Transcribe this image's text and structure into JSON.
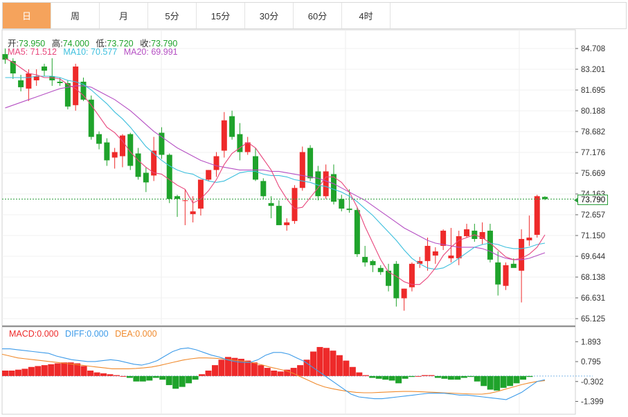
{
  "tabs": [
    {
      "label": "日",
      "active": true
    },
    {
      "label": "周",
      "active": false
    },
    {
      "label": "月",
      "active": false
    },
    {
      "label": "5分",
      "active": false
    },
    {
      "label": "15分",
      "active": false
    },
    {
      "label": "30分",
      "active": false
    },
    {
      "label": "60分",
      "active": false
    },
    {
      "label": "4时",
      "active": false
    }
  ],
  "ohlc_info": {
    "open_label": "开:",
    "open": "73.950",
    "high_label": "高:",
    "high": "74.000",
    "low_label": "低:",
    "low": "73.720",
    "close_label": "收:",
    "close": "73.790"
  },
  "ma_info": {
    "ma5_label": "MA5:",
    "ma5": "71.512",
    "ma10_label": "MA10:",
    "ma10": "70.577",
    "ma20_label": "MA20:",
    "ma20": "69.991"
  },
  "macd_info": {
    "macd_label": "MACD:",
    "macd": "0.000",
    "diff_label": "DIFF:",
    "diff": "0.000",
    "dea_label": "DEA:",
    "dea": "0.000"
  },
  "price_tag": "73.790",
  "colors": {
    "up": "#ee2a2a",
    "down": "#1fa32b",
    "ma5": "#e8467c",
    "ma10": "#3cbfdd",
    "ma20": "#b54fc3",
    "diff": "#3d9be9",
    "dea": "#f08a2c",
    "tab_active": "#f5a35c"
  },
  "chart_data": [
    {
      "type": "candlestick",
      "title": "",
      "y_ticks": [
        "84.708",
        "83.201",
        "81.695",
        "80.188",
        "78.682",
        "77.176",
        "75.669",
        "74.163",
        "72.657",
        "71.150",
        "69.644",
        "68.138",
        "66.631",
        "65.125"
      ],
      "ylim": [
        65.125,
        84.708
      ],
      "grid": true,
      "candles": [
        [
          84.3,
          84.7,
          83.6,
          83.9
        ],
        [
          83.8,
          84.0,
          82.5,
          82.9
        ],
        [
          82.4,
          82.8,
          81.6,
          81.9
        ],
        [
          81.8,
          83.2,
          80.9,
          82.9
        ],
        [
          82.4,
          83.2,
          82.0,
          82.7
        ],
        [
          83.4,
          83.6,
          82.7,
          83.1
        ],
        [
          82.7,
          84.0,
          82.0,
          82.4
        ],
        [
          82.3,
          82.6,
          82.0,
          82.2
        ],
        [
          82.2,
          82.4,
          80.3,
          80.5
        ],
        [
          80.6,
          83.6,
          80.2,
          83.4
        ],
        [
          82.3,
          82.6,
          80.9,
          81.0
        ],
        [
          81.0,
          81.3,
          78.1,
          78.3
        ],
        [
          78.5,
          78.7,
          77.4,
          77.8
        ],
        [
          77.9,
          78.2,
          76.2,
          76.6
        ],
        [
          76.8,
          77.5,
          76.0,
          77.2
        ],
        [
          76.9,
          78.5,
          76.1,
          78.4
        ],
        [
          78.5,
          78.6,
          75.9,
          76.2
        ],
        [
          77.1,
          77.5,
          75.2,
          75.4
        ],
        [
          75.7,
          76.1,
          74.3,
          75.0
        ],
        [
          75.5,
          78.3,
          75.1,
          77.3
        ],
        [
          78.6,
          79.0,
          76.7,
          77.0
        ],
        [
          77.0,
          77.1,
          73.5,
          73.8
        ],
        [
          74.0,
          74.1,
          72.5,
          73.8
        ],
        [
          73.7,
          74.5,
          71.9,
          73.7
        ],
        [
          72.7,
          74.0,
          72.1,
          72.9
        ],
        [
          73.1,
          75.2,
          72.6,
          75.2
        ],
        [
          75.2,
          75.9,
          75.1,
          75.9
        ],
        [
          75.9,
          77.2,
          75.4,
          76.9
        ],
        [
          77.3,
          80.1,
          76.8,
          79.5
        ],
        [
          79.8,
          80.2,
          78.1,
          78.3
        ],
        [
          78.5,
          79.3,
          76.6,
          77.2
        ],
        [
          77.2,
          78.3,
          77.0,
          77.9
        ],
        [
          76.9,
          77.5,
          75.1,
          75.2
        ],
        [
          75.1,
          75.3,
          73.8,
          74.0
        ],
        [
          73.5,
          74.0,
          72.4,
          73.3
        ],
        [
          73.3,
          73.7,
          71.9,
          71.9
        ],
        [
          71.9,
          72.4,
          71.5,
          72.1
        ],
        [
          72.2,
          74.8,
          72.0,
          74.6
        ],
        [
          74.6,
          77.6,
          74.4,
          77.2
        ],
        [
          77.5,
          77.7,
          75.1,
          75.3
        ],
        [
          75.8,
          76.2,
          73.7,
          74.0
        ],
        [
          74.0,
          76.3,
          73.8,
          75.8
        ],
        [
          75.6,
          76.3,
          73.4,
          73.6
        ],
        [
          73.8,
          74.1,
          72.9,
          73.1
        ],
        [
          73.1,
          74.5,
          72.8,
          73.0
        ],
        [
          73.0,
          73.2,
          69.6,
          69.8
        ],
        [
          69.6,
          70.4,
          68.9,
          69.2
        ],
        [
          69.3,
          69.4,
          68.5,
          69.0
        ],
        [
          68.8,
          69.0,
          68.3,
          68.5
        ],
        [
          68.6,
          69.1,
          67.1,
          67.5
        ],
        [
          69.1,
          69.3,
          66.0,
          66.6
        ],
        [
          66.6,
          67.3,
          65.7,
          67.3
        ],
        [
          67.4,
          69.2,
          67.1,
          69.1
        ],
        [
          69.1,
          69.6,
          68.8,
          69.3
        ],
        [
          69.3,
          71.0,
          68.6,
          70.4
        ],
        [
          69.7,
          70.3,
          69.1,
          70.0
        ],
        [
          70.4,
          71.6,
          70.1,
          71.5
        ],
        [
          69.5,
          71.7,
          69.2,
          69.7
        ],
        [
          69.5,
          71.5,
          69.0,
          71.1
        ],
        [
          71.1,
          72.0,
          71.0,
          71.6
        ],
        [
          71.5,
          72.0,
          70.7,
          70.9
        ],
        [
          70.9,
          72.1,
          70.5,
          71.4
        ],
        [
          71.5,
          72.0,
          69.2,
          69.4
        ],
        [
          69.2,
          70.0,
          66.8,
          67.6
        ],
        [
          67.5,
          69.2,
          67.2,
          69.0
        ],
        [
          69.1,
          69.5,
          68.9,
          68.8
        ],
        [
          68.6,
          71.6,
          66.3,
          70.9
        ],
        [
          70.8,
          72.6,
          70.4,
          71.0
        ],
        [
          71.2,
          74.1,
          71.0,
          74.0
        ],
        [
          73.95,
          74.0,
          73.72,
          73.79
        ]
      ],
      "ma5": [
        84.0,
        83.7,
        83.3,
        82.9,
        82.8,
        82.6,
        82.6,
        82.5,
        82.1,
        81.8,
        81.3,
        80.6,
        79.8,
        79.0,
        78.6,
        78.0,
        77.2,
        76.6,
        76.1,
        75.7,
        75.6,
        75.2,
        74.8,
        74.5,
        73.5,
        73.8,
        74.4,
        75.2,
        76.3,
        77.1,
        77.5,
        77.9,
        77.5,
        76.7,
        75.9,
        74.7,
        73.8,
        73.1,
        73.2,
        73.9,
        74.6,
        75.4,
        75.4,
        75.0,
        74.3,
        73.2,
        71.8,
        70.6,
        69.4,
        68.5,
        68.2,
        67.8,
        67.6,
        67.6,
        68.1,
        68.8,
        69.7,
        70.3,
        70.8,
        71.0,
        71.2,
        71.0,
        70.6,
        70.1,
        69.6,
        69.4,
        69.5,
        69.8,
        70.3,
        71.2
      ],
      "ma10": [
        82.6,
        82.6,
        82.6,
        82.6,
        82.7,
        82.7,
        82.7,
        82.6,
        82.4,
        82.3,
        82.1,
        81.7,
        81.2,
        80.7,
        80.1,
        79.6,
        79.0,
        78.3,
        77.6,
        77.1,
        76.6,
        76.2,
        75.9,
        75.7,
        75.6,
        75.3,
        75.1,
        75.0,
        75.1,
        75.4,
        75.7,
        75.8,
        75.8,
        75.6,
        75.5,
        75.5,
        75.4,
        75.2,
        75.1,
        75.0,
        74.8,
        74.7,
        74.5,
        74.3,
        74.0,
        73.6,
        73.1,
        72.6,
        72.0,
        71.4,
        70.8,
        70.1,
        69.5,
        69.1,
        68.8,
        68.7,
        68.8,
        69.1,
        69.5,
        69.9,
        70.3,
        70.5,
        70.6,
        70.5,
        70.3,
        70.2,
        70.2,
        70.3,
        70.5,
        70.6
      ],
      "ma20": [
        80.4,
        80.6,
        80.8,
        81.0,
        81.2,
        81.4,
        81.6,
        81.8,
        81.9,
        82.0,
        82.0,
        81.9,
        81.6,
        81.3,
        81.0,
        80.6,
        80.2,
        79.7,
        79.2,
        78.7,
        78.3,
        77.9,
        77.5,
        77.2,
        76.9,
        76.6,
        76.4,
        76.2,
        76.1,
        76.0,
        75.9,
        75.9,
        75.9,
        75.9,
        75.8,
        75.8,
        75.7,
        75.6,
        75.5,
        75.4,
        75.3,
        75.1,
        74.9,
        74.6,
        74.3,
        74.0,
        73.7,
        73.3,
        72.9,
        72.5,
        72.1,
        71.7,
        71.4,
        71.1,
        70.8,
        70.6,
        70.5,
        70.4,
        70.3,
        70.3,
        70.3,
        70.2,
        70.0,
        69.7,
        69.5,
        69.4,
        69.4,
        69.5,
        69.7,
        69.9
      ]
    },
    {
      "type": "macd",
      "title": "",
      "y_ticks": [
        "1.893",
        "0.795",
        "-0.302",
        "-1.399"
      ],
      "ylim": [
        -1.8,
        2.4
      ],
      "histogram": [
        0.3,
        0.3,
        0.35,
        0.4,
        0.5,
        0.55,
        0.6,
        0.65,
        0.7,
        0.75,
        0.75,
        0.7,
        0.55,
        0.3,
        0.2,
        0.15,
        0.1,
        0.05,
        0.0,
        -0.1,
        -0.3,
        -0.3,
        -0.25,
        -0.1,
        -0.2,
        -0.5,
        -0.7,
        -0.6,
        -0.4,
        -0.2,
        0.1,
        0.3,
        0.6,
        0.9,
        1.05,
        1.0,
        0.95,
        0.85,
        0.75,
        0.6,
        0.45,
        0.3,
        0.25,
        0.35,
        0.45,
        0.6,
        0.9,
        1.35,
        1.6,
        1.55,
        1.4,
        1.15,
        0.85,
        0.5,
        0.2,
        0.05,
        -0.1,
        -0.15,
        -0.2,
        -0.25,
        -0.4,
        -0.15,
        -0.05,
        0.0,
        0.05,
        0.05,
        -0.1,
        -0.15,
        -0.2,
        -0.2,
        -0.1,
        -0.05,
        -0.3,
        -0.55,
        -0.75,
        -0.8,
        -0.65,
        -0.55,
        -0.4,
        -0.2,
        -0.05
      ],
      "diff": [
        1.5,
        1.5,
        1.45,
        1.4,
        1.35,
        1.3,
        1.25,
        1.1,
        1.0,
        0.9,
        0.85,
        0.8,
        0.8,
        0.85,
        0.9,
        0.85,
        0.75,
        0.65,
        0.6,
        0.7,
        0.85,
        1.1,
        1.35,
        1.5,
        1.55,
        1.45,
        1.3,
        1.15,
        1.05,
        0.9,
        0.8,
        0.75,
        0.75,
        0.9,
        1.15,
        1.3,
        1.3,
        1.2,
        1.0,
        0.8,
        0.5,
        0.2,
        -0.1,
        -0.4,
        -0.7,
        -1.0,
        -1.15,
        -1.2,
        -1.25,
        -1.25,
        -1.2,
        -1.15,
        -1.1,
        -1.05,
        -1.0,
        -0.95,
        -0.95,
        -0.95,
        -1.0,
        -1.05,
        -1.05,
        -1.1,
        -1.15,
        -1.2,
        -1.25,
        -1.3,
        -1.1,
        -0.9,
        -0.6,
        -0.3,
        -0.2
      ],
      "dea": [
        1.2,
        1.1,
        1.0,
        0.95,
        0.9,
        0.85,
        0.8,
        0.75,
        0.7,
        0.65,
        0.6,
        0.55,
        0.5,
        0.45,
        0.4,
        0.4,
        0.4,
        0.42,
        0.45,
        0.5,
        0.58,
        0.68,
        0.78,
        0.88,
        0.95,
        1.0,
        1.0,
        0.98,
        0.95,
        0.9,
        0.85,
        0.8,
        0.72,
        0.62,
        0.5,
        0.4,
        0.3,
        0.15,
        -0.05,
        -0.25,
        -0.45,
        -0.6,
        -0.7,
        -0.78,
        -0.85,
        -0.9,
        -0.92,
        -0.92,
        -0.9,
        -0.88,
        -0.86,
        -0.85,
        -0.85,
        -0.86,
        -0.88,
        -0.9,
        -0.92,
        -0.94,
        -0.96,
        -0.98,
        -1.0,
        -1.0,
        -0.95,
        -0.85,
        -0.72,
        -0.6,
        -0.48,
        -0.38,
        -0.3,
        -0.25
      ]
    }
  ]
}
